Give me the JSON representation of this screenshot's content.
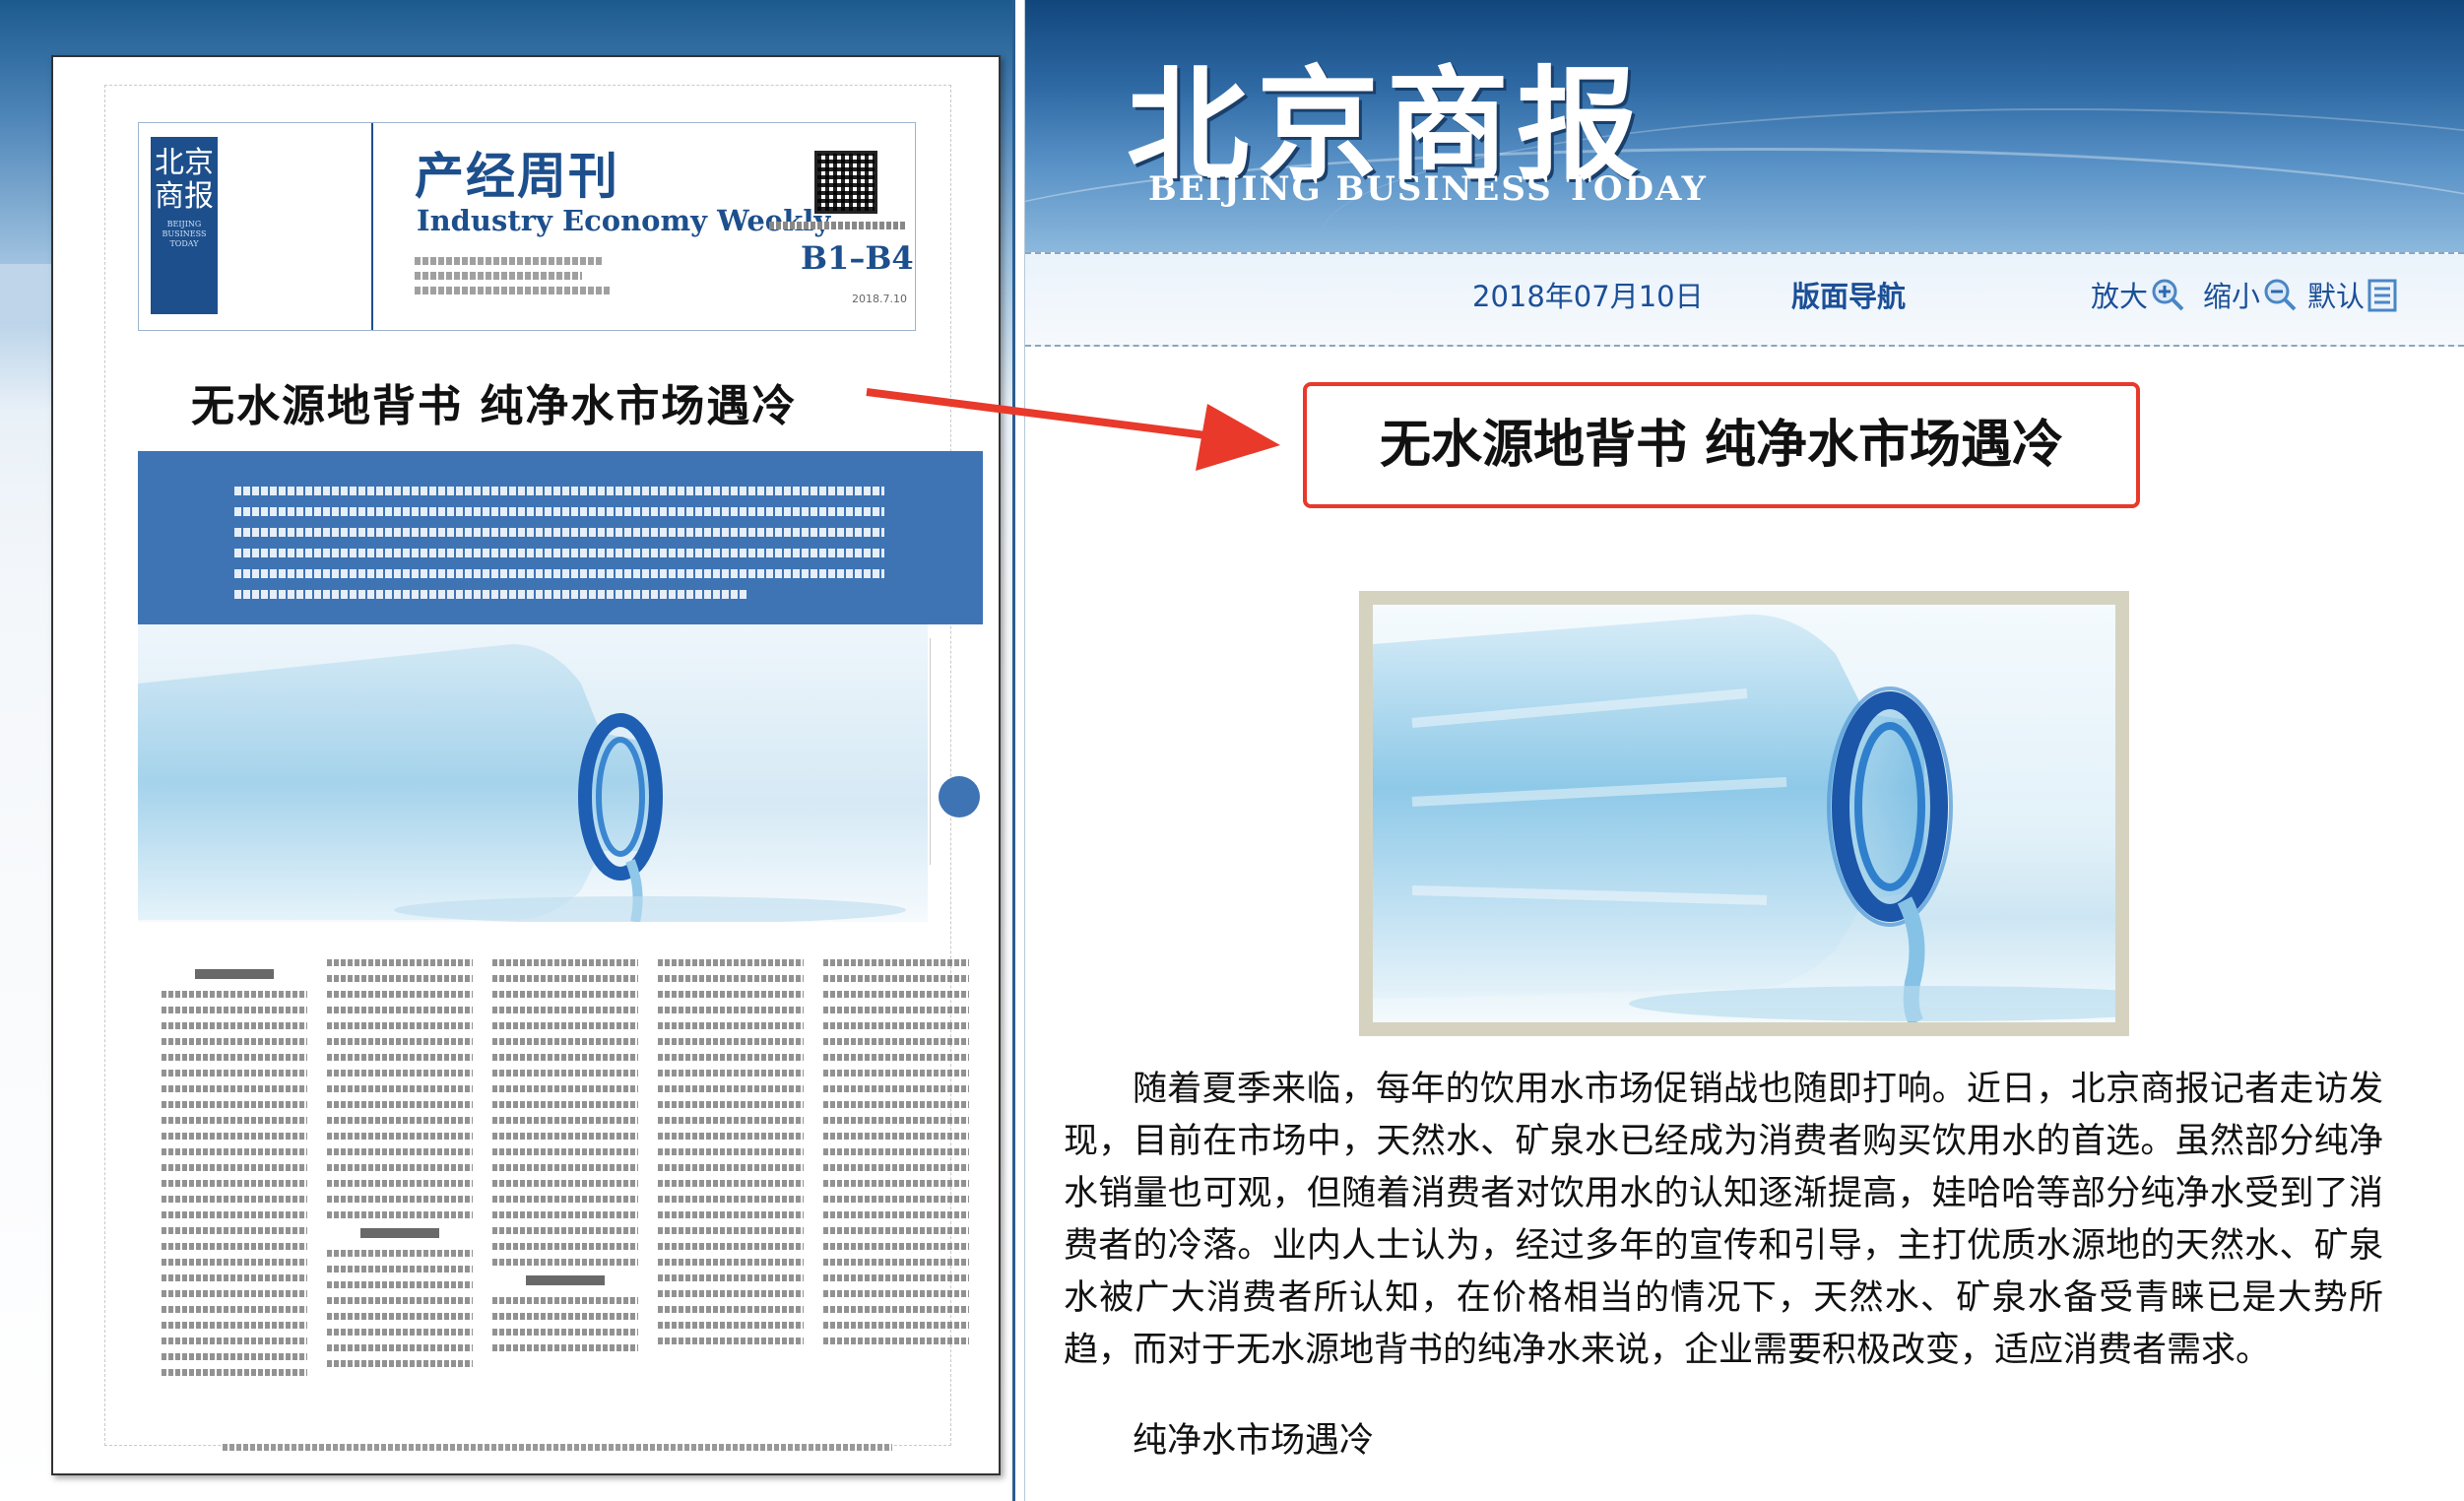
{
  "paper": {
    "logo": "北京商报",
    "logo_small": "BEIJING BUSINESS TODAY",
    "section_title_cn": "产经周刊",
    "section_title_en": "Industry Economy Weekly",
    "pages": "B1–B4",
    "date": "2018.7.10",
    "headline": "无水源地背书  纯净水市场遇冷"
  },
  "site": {
    "logo_cn": "北京商报",
    "logo_en": "BEIJING BUSINESS TODAY"
  },
  "toolbar": {
    "date": "2018年07月10日",
    "nav": "版面导航",
    "zoom_in": "放大",
    "zoom_out": "缩小",
    "default": "默认"
  },
  "article": {
    "headline": "无水源地背书  纯净水市场遇冷",
    "body": "随着夏季来临，每年的饮用水市场促销战也随即打响。近日，北京商报记者走访发现，目前在市场中，天然水、矿泉水已经成为消费者购买饮用水的首选。虽然部分纯净水销量也可观，但随着消费者对饮用水的认知逐渐提高，娃哈哈等部分纯净水受到了消费者的冷落。业内人士认为，经过多年的宣传和引导，主打优质水源地的天然水、矿泉水被广大消费者所认知，在价格相当的情况下，天然水、矿泉水备受青睐已是大势所趋，而对于无水源地背书的纯净水来说，企业需要积极改变，适应消费者需求。",
    "subhead": "纯净水市场遇冷"
  },
  "colors": {
    "brand_blue": "#1d4f8c",
    "highlight_red": "#e8392a",
    "toolbar_text": "#1b4f97"
  },
  "icons": [
    "zoom-in-icon",
    "zoom-out-icon",
    "list-icon",
    "arrow-icon"
  ]
}
